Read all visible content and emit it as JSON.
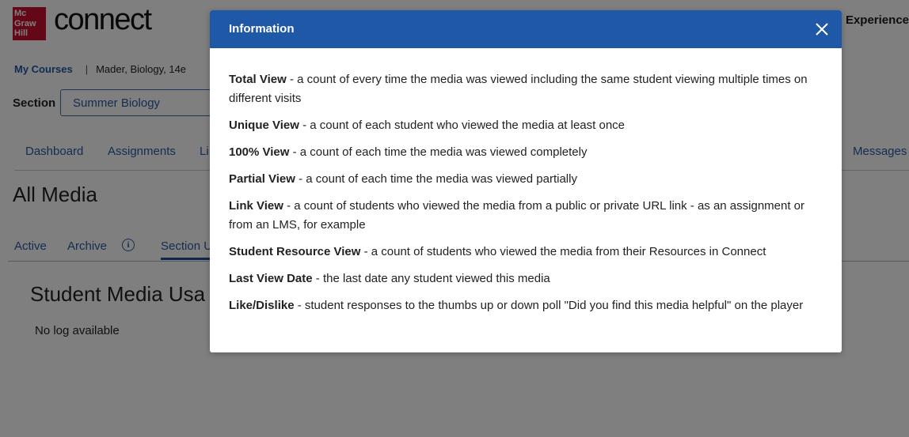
{
  "header": {
    "logo_lines": [
      "Mc",
      "Graw",
      "Hill"
    ],
    "app_name": "connect",
    "right_text": "Experience"
  },
  "breadcrumb": {
    "link": "My Courses",
    "separator": "|",
    "current": "Mader, Biology, 14e"
  },
  "section": {
    "label": "Section",
    "value": "Summer Biology"
  },
  "nav": {
    "items": [
      "Dashboard",
      "Assignments",
      "Li",
      "Messages"
    ]
  },
  "page_title": "All Media",
  "tabs": {
    "items": [
      "Active",
      "Archive",
      "Section U"
    ],
    "info_glyph": "i"
  },
  "media_usage": {
    "title": "Student Media Usa",
    "empty_text": "No log available"
  },
  "modal": {
    "title": "Information",
    "close_icon": "close-icon",
    "definitions": [
      {
        "term": "Total View",
        "desc": " - a count of every time the media was viewed including the same student viewing multiple times on different visits"
      },
      {
        "term": "Unique View",
        "desc": " - a count of each student who viewed the media at least once"
      },
      {
        "term": "100% View",
        "desc": " - a count of each time the media was viewed completely"
      },
      {
        "term": "Partial View",
        "desc": " - a count of each time the media was viewed partially"
      },
      {
        "term": "Link View",
        "desc": " - a count of students who viewed the media from a public or private URL link - as an assignment or from an LMS, for example"
      },
      {
        "term": "Student Resource View",
        "desc": " - a count of students who viewed the media from their Resources in Connect"
      },
      {
        "term": "Last View Date",
        "desc": " - the last date any student viewed this media"
      },
      {
        "term": "Like/Dislike",
        "desc": " - student responses to the thumbs up or down poll \"Did you find this media helpful\" on the player"
      }
    ]
  },
  "colors": {
    "brand_red": "#c8102e",
    "modal_header": "#1f58a6",
    "link_blue": "#2a5aa5"
  }
}
